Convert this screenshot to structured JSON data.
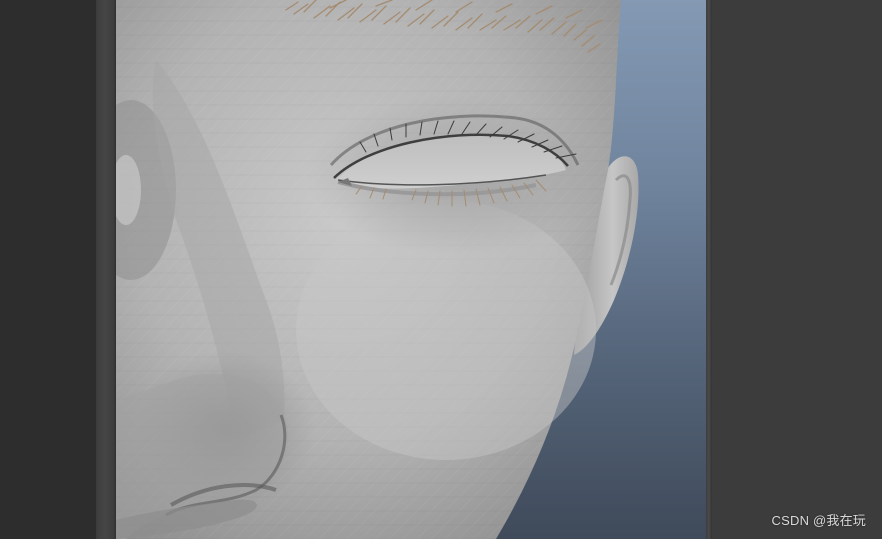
{
  "watermark": {
    "text": "CSDN @我在玩"
  },
  "colors": {
    "panel_background": "#2b2b2b",
    "right_panel": "#3c3c3c",
    "viewport_sky_top": "#8499b3",
    "viewport_sky_bottom": "#3f4a5a",
    "skin": "#b4b4b4",
    "hair": "#a89074"
  },
  "viewport": {
    "content": "3d-model-face-closeup"
  }
}
